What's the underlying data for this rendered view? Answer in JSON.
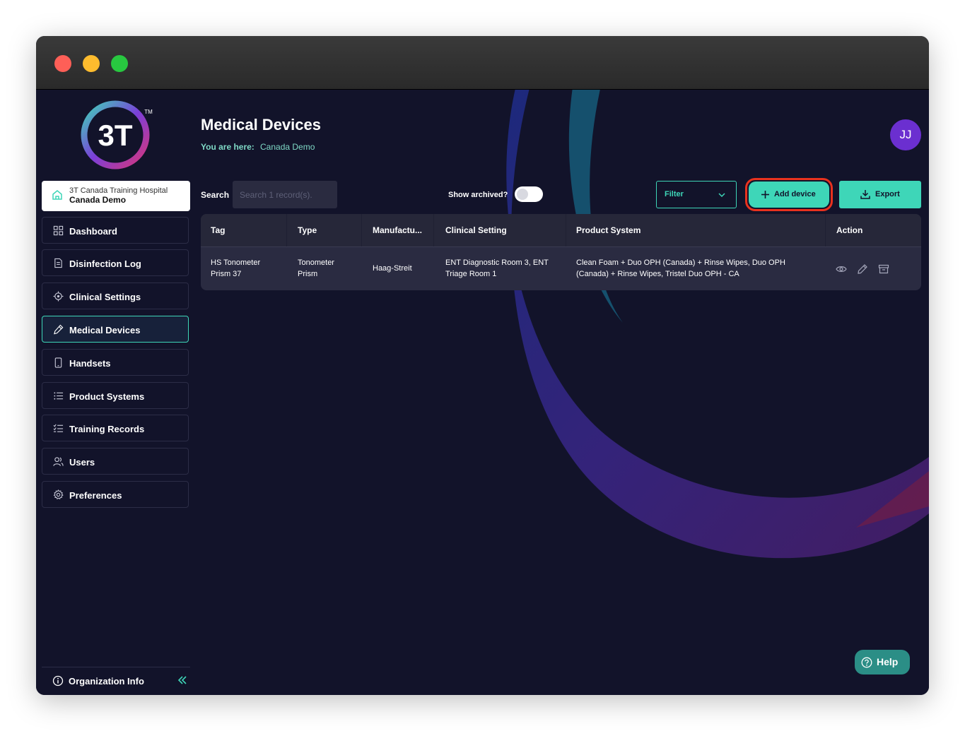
{
  "colors": {
    "accent": "#3ed6b8",
    "background": "#12132a",
    "avatar": "#6b2fd0",
    "highlight_ring": "#e8321e"
  },
  "logo": {
    "text": "3T",
    "tm": "TM"
  },
  "org": {
    "hospital": "3T Canada Training Hospital",
    "name": "Canada Demo",
    "icon": "home-icon"
  },
  "nav": [
    {
      "label": "Dashboard",
      "icon": "grid-icon",
      "active": false
    },
    {
      "label": "Disinfection Log",
      "icon": "document-icon",
      "active": false
    },
    {
      "label": "Clinical Settings",
      "icon": "target-icon",
      "active": false
    },
    {
      "label": "Medical Devices",
      "icon": "pen-icon",
      "active": true
    },
    {
      "label": "Handsets",
      "icon": "handset-icon",
      "active": false
    },
    {
      "label": "Product Systems",
      "icon": "list-icon",
      "active": false
    },
    {
      "label": "Training Records",
      "icon": "checklist-icon",
      "active": false
    },
    {
      "label": "Users",
      "icon": "users-icon",
      "active": false
    },
    {
      "label": "Preferences",
      "icon": "gear-icon",
      "active": false
    }
  ],
  "footer": {
    "org_info_label": "Organization Info",
    "collapse_icon": "double-chevron-left-icon"
  },
  "header": {
    "title": "Medical Devices",
    "crumb_label": "You are here:",
    "crumb_value": "Canada Demo",
    "avatar_initials": "JJ"
  },
  "toolbar": {
    "search_label": "Search",
    "search_placeholder": "Search 1 record(s).",
    "archived_label": "Show archived?",
    "archived_on": false,
    "filter_label": "Filter",
    "add_label": "Add device",
    "export_label": "Export"
  },
  "table": {
    "columns": [
      "Tag",
      "Type",
      "Manufactu...",
      "Clinical Setting",
      "Product System",
      "Action"
    ],
    "rows": [
      {
        "tag": "HS Tonometer Prism 37",
        "type": "Tonometer Prism",
        "manufacturer": "Haag-Streit",
        "clinical_setting": "ENT Diagnostic Room 3, ENT Triage Room 1",
        "product_system": "Clean Foam + Duo OPH (Canada) + Rinse Wipes, Duo OPH (Canada) + Rinse Wipes, Tristel Duo OPH - CA",
        "actions": [
          "eye-icon",
          "pencil-icon",
          "archive-icon"
        ]
      }
    ]
  },
  "help": {
    "label": "Help",
    "icon": "question-circle-icon"
  }
}
